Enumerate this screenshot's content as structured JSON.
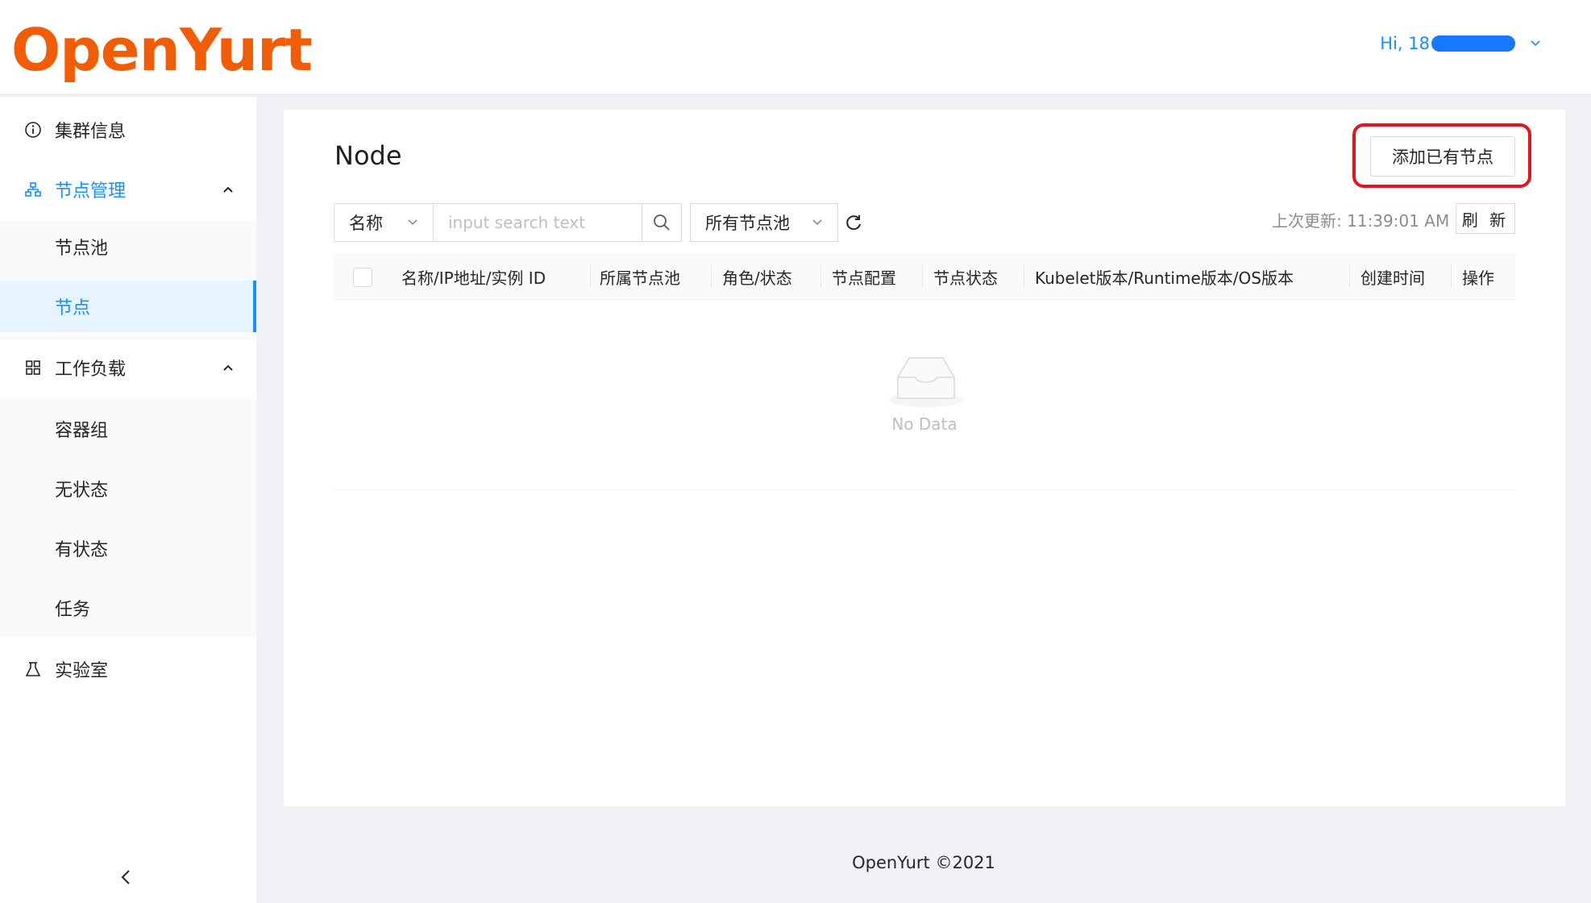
{
  "header": {
    "logo_text": "OpenYurt",
    "user_greeting": "Hi, 18"
  },
  "sidebar": {
    "items": [
      {
        "label": "集群信息",
        "icon": "info-circle-icon"
      },
      {
        "label": "节点管理",
        "icon": "cluster-icon",
        "expanded": true,
        "children": [
          {
            "label": "节点池"
          },
          {
            "label": "节点",
            "active": true
          }
        ]
      },
      {
        "label": "工作负载",
        "icon": "appstore-icon",
        "expanded": true,
        "children": [
          {
            "label": "容器组"
          },
          {
            "label": "无状态"
          },
          {
            "label": "有状态"
          },
          {
            "label": "任务"
          }
        ]
      },
      {
        "label": "实验室",
        "icon": "experiment-icon"
      }
    ],
    "collapse_icon": "chevron-left-icon"
  },
  "main": {
    "title": "Node",
    "add_button": "添加已有节点",
    "filter_field": "名称",
    "search_placeholder": "input search text",
    "pool_select": "所有节点池",
    "last_update": "上次更新: 11:39:01 AM",
    "refresh_button": "刷 新",
    "table": {
      "columns": [
        "名称/IP地址/实例 ID",
        "所属节点池",
        "角色/状态",
        "节点配置",
        "节点状态",
        "Kubelet版本/Runtime版本/OS版本",
        "创建时间",
        "操作"
      ],
      "empty_text": "No Data"
    }
  },
  "footer": {
    "text": "OpenYurt ©2021"
  },
  "colors": {
    "brand": "#f25c05",
    "primary": "#1890ff",
    "highlight": "#e5131d"
  }
}
